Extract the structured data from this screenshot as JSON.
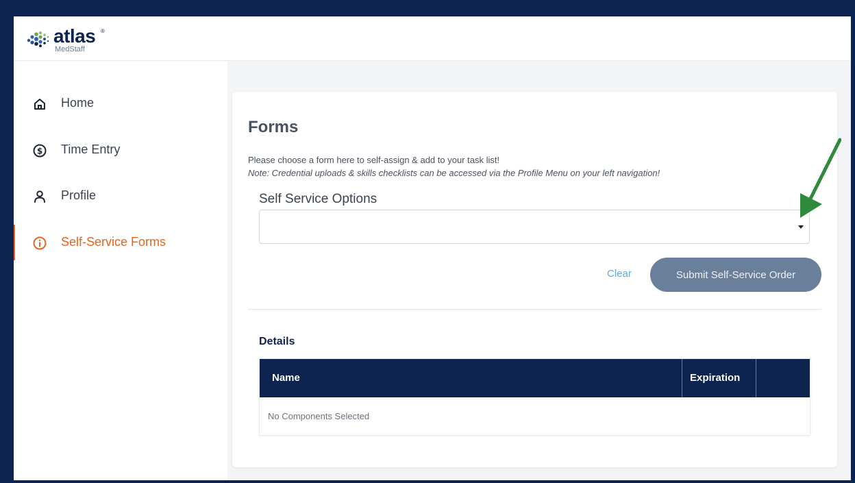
{
  "brand": {
    "name": "atlas",
    "sub": "MedStaff",
    "reg": "®"
  },
  "sidebar": {
    "items": [
      {
        "label": "Home",
        "icon": "home-icon",
        "active": false
      },
      {
        "label": "Time Entry",
        "icon": "dollar-circle-icon",
        "active": false
      },
      {
        "label": "Profile",
        "icon": "user-icon",
        "active": false
      },
      {
        "label": "Self-Service Forms",
        "icon": "info-circle-icon",
        "active": true
      }
    ]
  },
  "main": {
    "title": "Forms",
    "intro": "Please choose a form here to self-assign & add to your task list!",
    "note": "Note: Credential uploads & skills checklists can be accessed via the Profile Menu on your left navigation!",
    "options_label": "Self Service Options",
    "select_value": "",
    "clear_label": "Clear",
    "submit_label": "Submit Self-Service Order",
    "details_title": "Details",
    "table": {
      "columns": [
        "Name",
        "Expiration",
        ""
      ],
      "empty_text": "No Components Selected"
    }
  },
  "colors": {
    "navy": "#0d2451",
    "accent": "#e8631b",
    "link": "#5aa9e6",
    "button": "#6a7f99",
    "arrow": "#2e8b3c"
  }
}
